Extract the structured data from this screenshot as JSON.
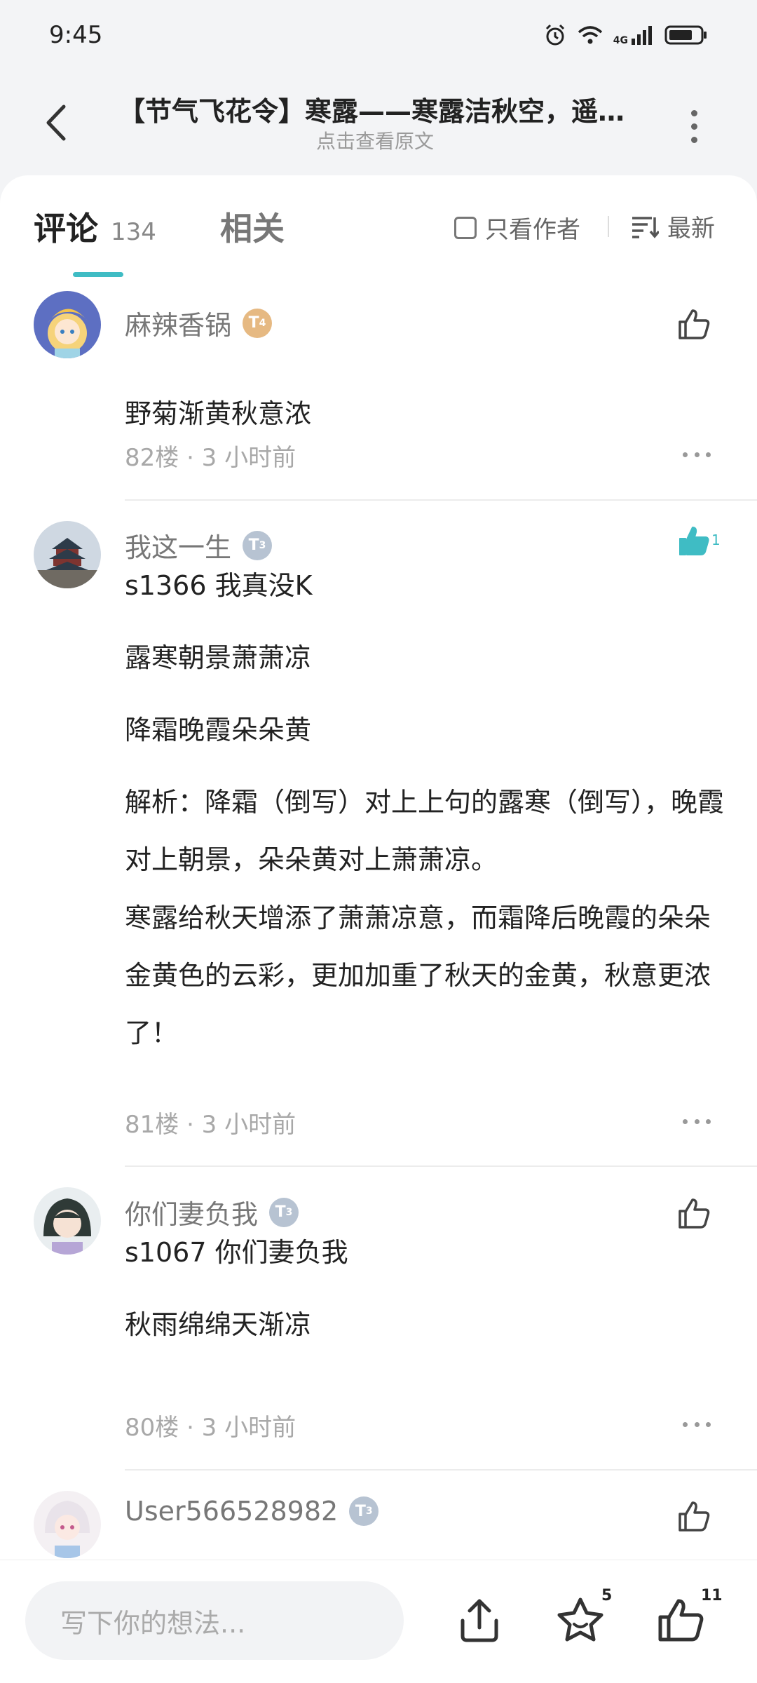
{
  "status": {
    "time": "9:45",
    "network": "4G"
  },
  "header": {
    "title": "【节气飞花令】寒露——寒露洁秋空，遥…",
    "subtitle": "点击查看原文"
  },
  "tabs": {
    "comments_label": "评论",
    "comments_count": "134",
    "related_label": "相关",
    "author_only_label": "只看作者",
    "sort_label": "最新"
  },
  "comments": [
    {
      "username": "麻辣香锅",
      "level": "4",
      "lines": [
        "野菊渐黄秋意浓"
      ],
      "meta": "82楼 · 3 小时前",
      "likes": ""
    },
    {
      "username": "我这一生",
      "level": "3",
      "lines": [
        "s1366  我真没K",
        "露寒朝景萧萧凉",
        "降霜晚霞朵朵黄",
        "解析：降霜（倒写）对上上句的露寒（倒写），晚霞对上朝景，朵朵黄对上萧萧凉。",
        "寒露给秋天增添了萧萧凉意，而霜降后晚霞的朵朵金黄色的云彩，更加加重了秋天的金黄，秋意更浓了！"
      ],
      "meta": "81楼 · 3 小时前",
      "likes": "1"
    },
    {
      "username": "你们妻负我",
      "level": "3",
      "lines": [
        "s1067  你们妻负我",
        "秋雨绵绵天渐凉"
      ],
      "meta": "80楼 · 3 小时前",
      "likes": ""
    },
    {
      "username": "User566528982",
      "level": "3",
      "lines": [],
      "meta": "",
      "likes": ""
    }
  ],
  "bottom": {
    "input_placeholder": "写下你的想法...",
    "favorites_count": "5",
    "likes_count": "11"
  },
  "colors": {
    "accent": "#3fbcc4",
    "gold_badge": "#e6b982",
    "silver_badge": "#b7c3d2"
  },
  "icons": [
    "back-arrow-icon",
    "more-vertical-icon",
    "checkbox-icon",
    "sort-icon",
    "thumbs-up-icon",
    "share-icon",
    "star-icon",
    "alarm-icon",
    "wifi-icon",
    "signal-icon",
    "battery-icon"
  ]
}
